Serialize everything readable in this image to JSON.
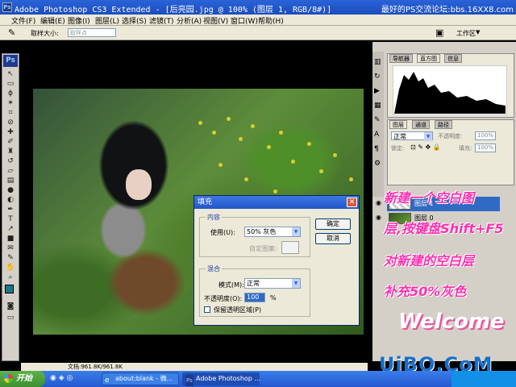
{
  "window": {
    "title": "Adobe Photoshop CS3 Extended - [后亮园.jpg @ 100% (图层 1, RGB/8#)]",
    "watermark": "最好的PS交流论坛:bbs.16XX8.com"
  },
  "menus": [
    "文件(F)",
    "编辑(E)",
    "图像(I)",
    "图层(L)",
    "选择(S)",
    "滤镜(T)",
    "分析(A)",
    "视图(V)",
    "窗口(W)",
    "帮助(H)"
  ],
  "options": {
    "sample_size_label": "取样大小:",
    "sample_size_value": "取样点",
    "workspace_label": "工作区"
  },
  "panels": {
    "top_tabs": [
      "导航器",
      "直方图",
      "信息"
    ],
    "layer_tabs": [
      "图层",
      "通道",
      "路径"
    ],
    "blend_mode": "正常",
    "opacity_label": "不透明度:",
    "opacity_value": "100%",
    "lock_label": "锁定:",
    "fill_label": "填充:",
    "fill_value": "100%",
    "layers": [
      {
        "name": "图层 1"
      },
      {
        "name": "图层 0"
      }
    ]
  },
  "dialog": {
    "title": "填充",
    "content_group": "内容",
    "use_label": "使用(U):",
    "use_value": "50% 灰色",
    "custom_pattern_label": "自定图案:",
    "blend_group": "混合",
    "mode_label": "模式(M):",
    "mode_value": "正常",
    "opacity_label": "不透明度(O):",
    "opacity_value": "100",
    "percent": "%",
    "preserve_label": "保留透明区域(P)",
    "ok": "确定",
    "cancel": "取消"
  },
  "annotations": [
    "新建一个空白图",
    "层,按键盘Shift+F5",
    "对新建的空白层",
    "补充50%灰色"
  ],
  "welcome": "Welcome",
  "brand": "UiBQ.CoM",
  "status": "文档:961.8K/961.8K",
  "taskbar": {
    "start": "开始",
    "task1": "about:blank - 微...",
    "task2": "Adobe Photoshop ..."
  },
  "colors": {
    "annotation": "#ff2fb0",
    "foreground": "#1a7a8c",
    "background": "#ffffff"
  }
}
